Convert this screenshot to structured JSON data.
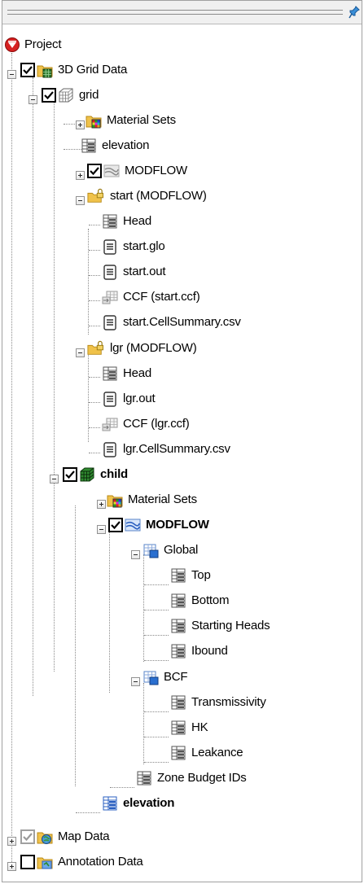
{
  "tree": {
    "project": "Project",
    "grid_data": "3D Grid Data",
    "grid": "grid",
    "grid_material_sets": "Material Sets",
    "grid_elevation": "elevation",
    "grid_modflow": "MODFLOW",
    "start": "start (MODFLOW)",
    "start_head": "Head",
    "start_glo": "start.glo",
    "start_out": "start.out",
    "start_ccf": "CCF (start.ccf)",
    "start_csv": "start.CellSummary.csv",
    "lgr": "lgr (MODFLOW)",
    "lgr_head": "Head",
    "lgr_out": "lgr.out",
    "lgr_ccf": "CCF (lgr.ccf)",
    "lgr_csv": "lgr.CellSummary.csv",
    "child": "child",
    "child_material_sets": "Material Sets",
    "child_modflow": "MODFLOW",
    "global": "Global",
    "top": "Top",
    "bottom": "Bottom",
    "starting_heads": "Starting Heads",
    "ibound": "Ibound",
    "bcf": "BCF",
    "transmissivity": "Transmissivity",
    "hk": "HK",
    "leakance": "Leakance",
    "zone_budget": "Zone Budget IDs",
    "child_elevation": "elevation",
    "map_data": "Map Data",
    "annotation_data": "Annotation Data"
  },
  "colors": {
    "project_icon": "#d62020",
    "folder": "#f0c24a",
    "grid_green": "#2a8a2a",
    "modflow_blue": "#2a5fc0",
    "tree_lines": "#8a8a8a"
  }
}
